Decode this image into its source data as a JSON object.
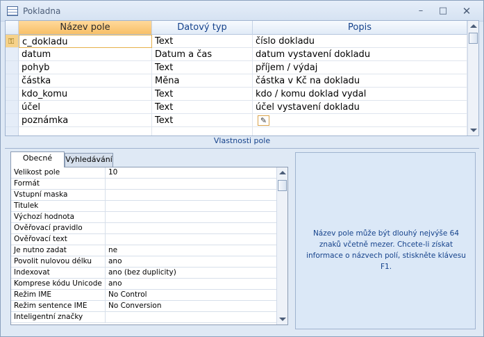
{
  "window": {
    "title": "Pokladna",
    "minimize_glyph": "–",
    "maximize_glyph": "□",
    "close_glyph": "✕"
  },
  "grid": {
    "headers": [
      "Název pole",
      "Datový typ",
      "Popis"
    ],
    "rows": [
      {
        "name": "c_dokladu",
        "type": "Text",
        "desc": "číslo dokladu"
      },
      {
        "name": "datum",
        "type": "Datum a čas",
        "desc": "datum vystavení dokladu"
      },
      {
        "name": "pohyb",
        "type": "Text",
        "desc": "příjem / výdaj"
      },
      {
        "name": "částka",
        "type": "Měna",
        "desc": "částka v Kč na dokladu"
      },
      {
        "name": "kdo_komu",
        "type": "Text",
        "desc": "kdo / komu doklad vydal"
      },
      {
        "name": "účel",
        "type": "Text",
        "desc": "účel vystavení dokladu"
      },
      {
        "name": "poznámka",
        "type": "Text",
        "desc": ""
      }
    ],
    "primary_key_icon": "key-icon",
    "builder_icon": "builder-icon"
  },
  "field_properties_label": "Vlastnosti pole",
  "tabs": [
    "Obecné",
    "Vyhledávání"
  ],
  "properties": [
    {
      "name": "Velikost pole",
      "value": "10"
    },
    {
      "name": "Formát",
      "value": ""
    },
    {
      "name": "Vstupní maska",
      "value": ""
    },
    {
      "name": "Titulek",
      "value": ""
    },
    {
      "name": "Výchozí hodnota",
      "value": ""
    },
    {
      "name": "Ověřovací pravidlo",
      "value": ""
    },
    {
      "name": "Ověřovací text",
      "value": ""
    },
    {
      "name": "Je nutno zadat",
      "value": "ne"
    },
    {
      "name": "Povolit nulovou délku",
      "value": "ano"
    },
    {
      "name": "Indexovat",
      "value": "ano (bez duplicity)"
    },
    {
      "name": "Komprese kódu Unicode",
      "value": "ano"
    },
    {
      "name": "Režim IME",
      "value": "No Control"
    },
    {
      "name": "Režim sentence IME",
      "value": "No Conversion"
    },
    {
      "name": "Inteligentní značky",
      "value": ""
    }
  ],
  "help_text": "Název pole může být dlouhý nejvýše 64 znaků včetně mezer. Chcete-li získat informace o názvech polí, stiskněte klávesu F1.",
  "colors": {
    "selected_header": "#f8c067",
    "accent_text": "#15428b",
    "frame": "#dfe9f5"
  }
}
